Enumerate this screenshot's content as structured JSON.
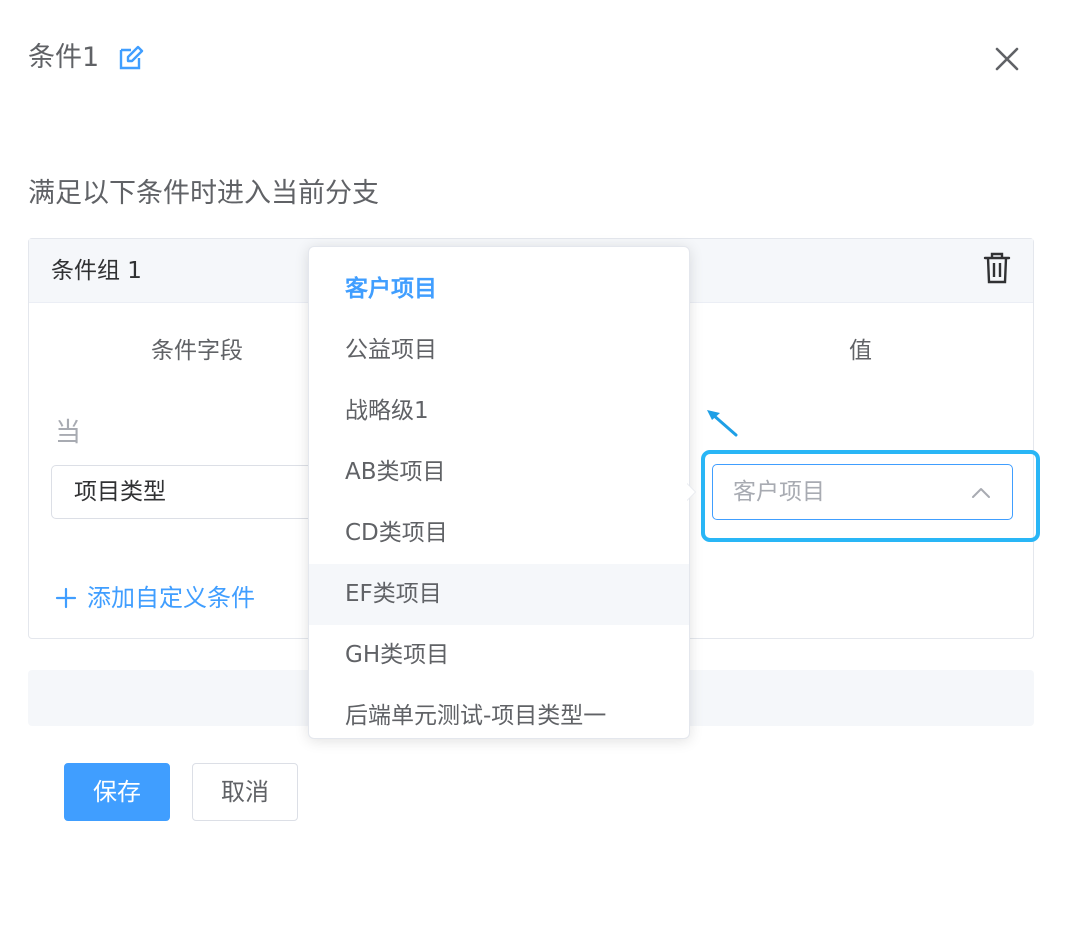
{
  "header": {
    "title": "条件1",
    "edit_icon": "edit-icon",
    "close_icon": "close-icon"
  },
  "subtitle": "满足以下条件时进入当前分支",
  "group": {
    "title": "条件组 1",
    "delete_icon": "trash-icon",
    "col_field": "条件字段",
    "col_value": "值",
    "when": "当",
    "field_value": "项目类型",
    "value_placeholder": "客户项目",
    "add_condition": "添加自定义条件"
  },
  "dropdown": {
    "selected": "客户项目",
    "hovered": "EF类项目",
    "options": [
      "客户项目",
      "公益项目",
      "战略级1",
      "AB类项目",
      "CD类项目",
      "EF类项目",
      "GH类项目",
      "后端单元测试-项目类型一"
    ]
  },
  "buttons": {
    "save": "保存",
    "cancel": "取消"
  },
  "colors": {
    "primary": "#409eff",
    "highlight": "#29b6f6",
    "text": "#606266"
  }
}
